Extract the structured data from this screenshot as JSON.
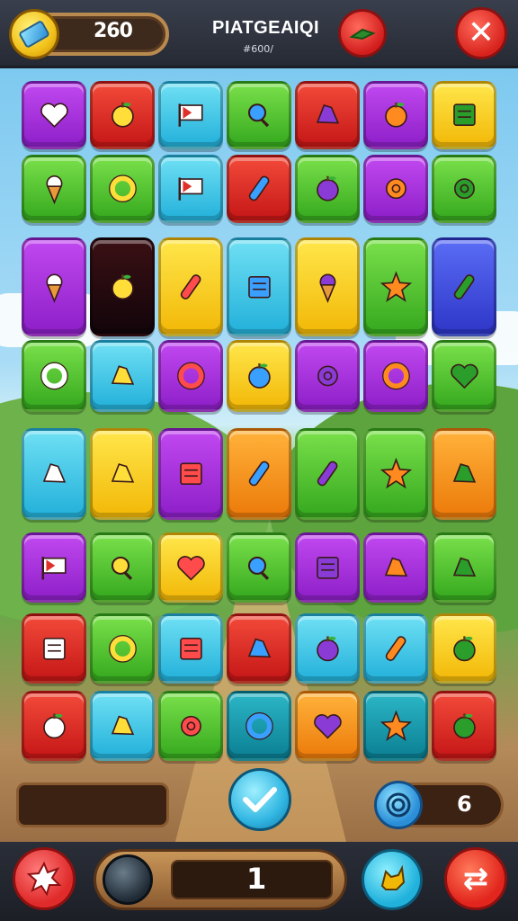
{
  "header": {
    "coins": "260",
    "title": "PIATGEAIQI",
    "subtitle": "#600/"
  },
  "footer": {
    "right_counter": "6",
    "level_value": "1"
  },
  "tiles": [
    {
      "row": 0,
      "col": 0,
      "color": "purple",
      "icon": "heart-icon"
    },
    {
      "row": 0,
      "col": 1,
      "color": "red",
      "icon": "lemon-icon"
    },
    {
      "row": 0,
      "col": 2,
      "color": "cyan",
      "icon": "flag-icon"
    },
    {
      "row": 0,
      "col": 3,
      "color": "green",
      "icon": "magnifier-icon"
    },
    {
      "row": 0,
      "col": 4,
      "color": "red",
      "icon": "bacon-icon"
    },
    {
      "row": 0,
      "col": 5,
      "color": "purple",
      "icon": "apple-icon"
    },
    {
      "row": 0,
      "col": 6,
      "color": "yellow",
      "icon": "bowl-icon"
    },
    {
      "row": 1,
      "col": 0,
      "color": "green",
      "icon": "ice-cream-icon"
    },
    {
      "row": 1,
      "col": 1,
      "color": "green",
      "icon": "ring-icon"
    },
    {
      "row": 1,
      "col": 2,
      "color": "cyan",
      "icon": "flag-icon"
    },
    {
      "row": 1,
      "col": 3,
      "color": "red",
      "icon": "pickle-icon"
    },
    {
      "row": 1,
      "col": 4,
      "color": "green",
      "icon": "ball-icon"
    },
    {
      "row": 1,
      "col": 5,
      "color": "purple",
      "icon": "spiral-icon"
    },
    {
      "row": 1,
      "col": 6,
      "color": "green",
      "icon": "flower-icon"
    },
    {
      "row": 2,
      "col": 0,
      "color": "purple",
      "icon": "ice-cream-cone-icon"
    },
    {
      "row": 2,
      "col": 1,
      "color": "dark",
      "icon": "apple-icon"
    },
    {
      "row": 2,
      "col": 2,
      "color": "yellow",
      "icon": "carrot-icon"
    },
    {
      "row": 2,
      "col": 3,
      "color": "cyan",
      "icon": "noodle-bowl-icon"
    },
    {
      "row": 2,
      "col": 4,
      "color": "yellow",
      "icon": "ice-cream-cone-icon"
    },
    {
      "row": 2,
      "col": 5,
      "color": "green",
      "icon": "star-icon"
    },
    {
      "row": 2,
      "col": 6,
      "color": "blue",
      "icon": "chili-icon"
    },
    {
      "row": 3,
      "col": 0,
      "color": "green",
      "icon": "letter-d-icon"
    },
    {
      "row": 3,
      "col": 1,
      "color": "cyan",
      "icon": "squiggle-icon"
    },
    {
      "row": 3,
      "col": 2,
      "color": "purple",
      "icon": "donut-icon"
    },
    {
      "row": 3,
      "col": 3,
      "color": "yellow",
      "icon": "blueberry-icon"
    },
    {
      "row": 3,
      "col": 4,
      "color": "purple",
      "icon": "sparkle-icon"
    },
    {
      "row": 3,
      "col": 5,
      "color": "purple",
      "icon": "ring-icon"
    },
    {
      "row": 3,
      "col": 6,
      "color": "green",
      "icon": "heart-icon"
    },
    {
      "row": 4,
      "col": 0,
      "color": "cyan",
      "icon": "tree-icon"
    },
    {
      "row": 4,
      "col": 1,
      "color": "yellow",
      "icon": "map-pin-icon"
    },
    {
      "row": 4,
      "col": 2,
      "color": "purple",
      "icon": "bag-icon"
    },
    {
      "row": 4,
      "col": 3,
      "color": "orange",
      "icon": "pencil-icon"
    },
    {
      "row": 4,
      "col": 4,
      "color": "green",
      "icon": "brush-icon"
    },
    {
      "row": 4,
      "col": 5,
      "color": "green",
      "icon": "star-icon"
    },
    {
      "row": 4,
      "col": 6,
      "color": "orange",
      "icon": "robot-icon"
    },
    {
      "row": 5,
      "col": 0,
      "color": "purple",
      "icon": "flag-icon"
    },
    {
      "row": 5,
      "col": 1,
      "color": "green",
      "icon": "magnifier-icon"
    },
    {
      "row": 5,
      "col": 2,
      "color": "yellow",
      "icon": "heart-icon"
    },
    {
      "row": 5,
      "col": 3,
      "color": "green",
      "icon": "magnifier-icon"
    },
    {
      "row": 5,
      "col": 4,
      "color": "purple",
      "icon": "ruler-icon"
    },
    {
      "row": 5,
      "col": 5,
      "color": "purple",
      "icon": "wrench-icon"
    },
    {
      "row": 5,
      "col": 6,
      "color": "green",
      "icon": "key-icon"
    },
    {
      "row": 6,
      "col": 0,
      "color": "red",
      "icon": "box-icon"
    },
    {
      "row": 6,
      "col": 1,
      "color": "green",
      "icon": "ring-icon"
    },
    {
      "row": 6,
      "col": 2,
      "color": "cyan",
      "icon": "document-icon"
    },
    {
      "row": 6,
      "col": 3,
      "color": "red",
      "icon": "paper-plane-icon"
    },
    {
      "row": 6,
      "col": 4,
      "color": "cyan",
      "icon": "blob-icon"
    },
    {
      "row": 6,
      "col": 5,
      "color": "cyan",
      "icon": "sausage-icon"
    },
    {
      "row": 6,
      "col": 6,
      "color": "yellow",
      "icon": "cookie-icon"
    },
    {
      "row": 7,
      "col": 0,
      "color": "red",
      "icon": "striped-ball-icon"
    },
    {
      "row": 7,
      "col": 1,
      "color": "cyan",
      "icon": "lock-icon"
    },
    {
      "row": 7,
      "col": 2,
      "color": "green",
      "icon": "gear-icon"
    },
    {
      "row": 7,
      "col": 3,
      "color": "teal",
      "icon": "ring-icon"
    },
    {
      "row": 7,
      "col": 4,
      "color": "orange",
      "icon": "heart-icon"
    },
    {
      "row": 7,
      "col": 5,
      "color": "teal",
      "icon": "star-icon"
    },
    {
      "row": 7,
      "col": 6,
      "color": "red",
      "icon": "lemon-icon"
    }
  ]
}
